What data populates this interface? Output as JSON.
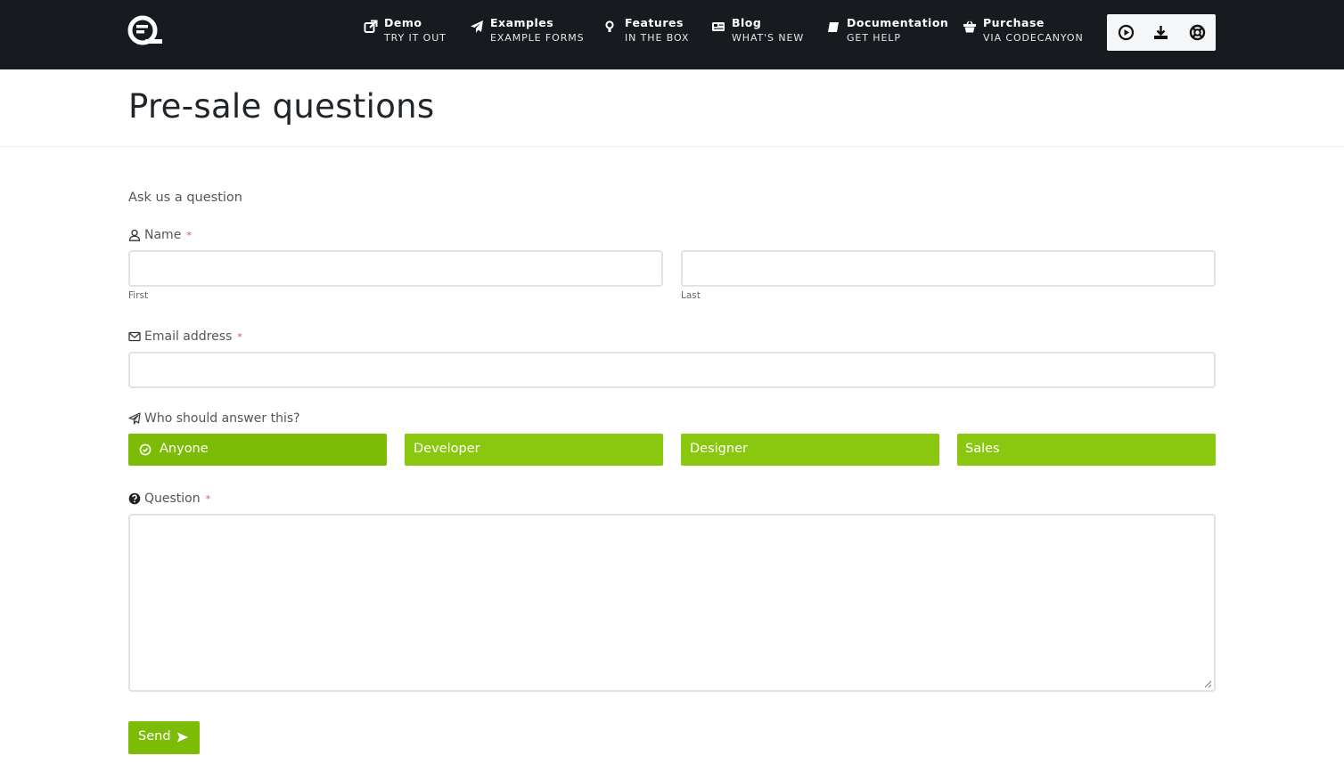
{
  "nav": {
    "items": [
      {
        "title": "Demo",
        "subtitle": "TRY IT OUT",
        "icon": "external-link-icon"
      },
      {
        "title": "Examples",
        "subtitle": "EXAMPLE FORMS",
        "icon": "paper-plane-icon"
      },
      {
        "title": "Features",
        "subtitle": "IN THE BOX",
        "icon": "lightbulb-icon"
      },
      {
        "title": "Blog",
        "subtitle": "WHAT'S NEW",
        "icon": "newspaper-icon"
      },
      {
        "title": "Documentation",
        "subtitle": "GET HELP",
        "icon": "book-icon"
      },
      {
        "title": "Purchase",
        "subtitle": "VIA CODECANYON",
        "icon": "basket-icon"
      }
    ],
    "tools": [
      "play-icon",
      "download-icon",
      "lifebuoy-icon"
    ]
  },
  "page": {
    "title": "Pre-sale questions"
  },
  "form": {
    "intro": "Ask us a question",
    "name": {
      "label": "Name",
      "required_mark": "*",
      "first_sublabel": "First",
      "last_sublabel": "Last",
      "first_value": "",
      "last_value": ""
    },
    "email": {
      "label": "Email address",
      "required_mark": "*",
      "value": ""
    },
    "recipient": {
      "label": "Who should answer this?",
      "options": [
        "Anyone",
        "Developer",
        "Designer",
        "Sales"
      ],
      "selected": "Anyone"
    },
    "question": {
      "label": "Question",
      "required_mark": "*",
      "value": ""
    },
    "submit_label": "Send"
  },
  "colors": {
    "topbar": "#171b1f",
    "accent": "#8ac80f",
    "accent_selected": "#7cbc06",
    "required": "#d9534f"
  }
}
